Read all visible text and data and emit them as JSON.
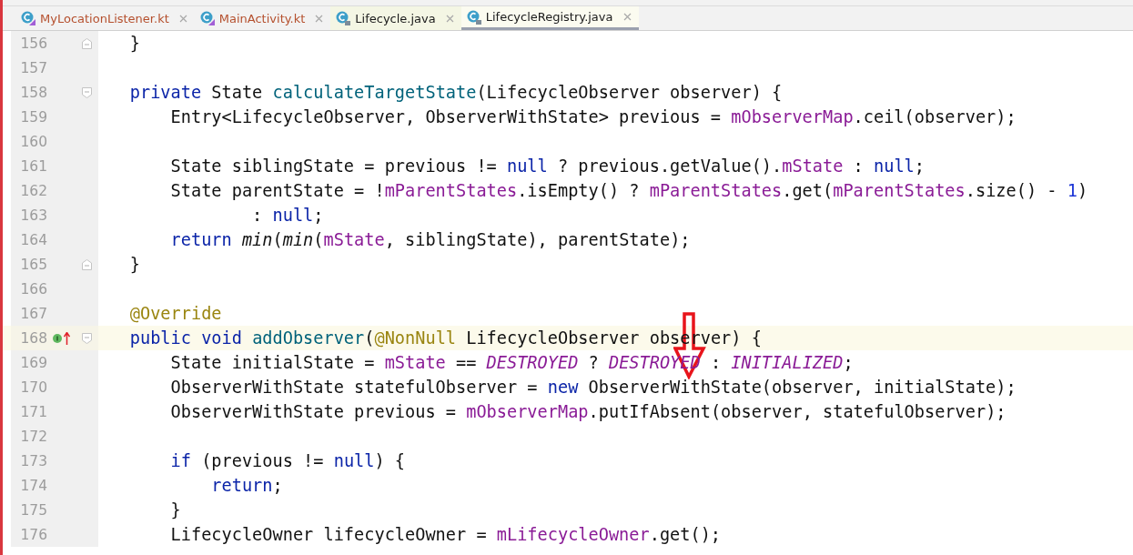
{
  "tabs": [
    {
      "label": "MyLocationListener.kt",
      "kind": "kotlin",
      "color": "#b5502e",
      "selected": false
    },
    {
      "label": "MainActivity.kt",
      "kind": "kotlin",
      "color": "#b5502e",
      "selected": false
    },
    {
      "label": "Lifecycle.java",
      "kind": "java",
      "color": "#1a1a1a",
      "selected": false
    },
    {
      "label": "LifecycleRegistry.java",
      "kind": "java",
      "color": "#1a1a1a",
      "selected": true
    }
  ],
  "editor": {
    "lines": [
      {
        "number": "156",
        "fold": {
          "kind": "end"
        },
        "tokens": [
          {
            "kind": "plain",
            "text": "    }"
          }
        ]
      },
      {
        "number": "157"
      },
      {
        "number": "158",
        "fold": {
          "kind": "start"
        },
        "tokens": [
          {
            "kind": "keyword",
            "text": "    private"
          },
          {
            "kind": "plain",
            "text": " State "
          },
          {
            "kind": "method",
            "text": "calculateTargetState"
          },
          {
            "kind": "plain",
            "text": "(LifecycleObserver observer) {"
          }
        ]
      },
      {
        "number": "159",
        "tokens": [
          {
            "kind": "plain",
            "text": "        Entry<LifecycleObserver, ObserverWithState> previous = "
          },
          {
            "kind": "field",
            "text": "mObserverMap"
          },
          {
            "kind": "plain",
            "text": ".ceil(observer);"
          }
        ]
      },
      {
        "number": "160"
      },
      {
        "number": "161",
        "tokens": [
          {
            "kind": "plain",
            "text": "        State siblingState = previous != "
          },
          {
            "kind": "keyword",
            "text": "null"
          },
          {
            "kind": "plain",
            "text": " ? previous.getValue()."
          },
          {
            "kind": "field",
            "text": "mState"
          },
          {
            "kind": "plain",
            "text": " : "
          },
          {
            "kind": "keyword",
            "text": "null"
          },
          {
            "kind": "plain",
            "text": ";"
          }
        ]
      },
      {
        "number": "162",
        "tokens": [
          {
            "kind": "plain",
            "text": "        State parentState = !"
          },
          {
            "kind": "field",
            "text": "mParentStates"
          },
          {
            "kind": "plain",
            "text": ".isEmpty() ? "
          },
          {
            "kind": "field",
            "text": "mParentStates"
          },
          {
            "kind": "plain",
            "text": ".get("
          },
          {
            "kind": "field",
            "text": "mParentStates"
          },
          {
            "kind": "plain",
            "text": ".size() - "
          },
          {
            "kind": "number",
            "text": "1"
          },
          {
            "kind": "plain",
            "text": ")"
          }
        ]
      },
      {
        "number": "163",
        "tokens": [
          {
            "kind": "plain",
            "text": "                : "
          },
          {
            "kind": "keyword",
            "text": "null"
          },
          {
            "kind": "plain",
            "text": ";"
          }
        ]
      },
      {
        "number": "164",
        "tokens": [
          {
            "kind": "keyword",
            "text": "        return "
          },
          {
            "kind": "static",
            "text": "min"
          },
          {
            "kind": "plain",
            "text": "("
          },
          {
            "kind": "static",
            "text": "min"
          },
          {
            "kind": "plain",
            "text": "("
          },
          {
            "kind": "field",
            "text": "mState"
          },
          {
            "kind": "plain",
            "text": ", siblingState), parentState);"
          }
        ]
      },
      {
        "number": "165",
        "fold": {
          "kind": "end"
        },
        "tokens": [
          {
            "kind": "plain",
            "text": "    }"
          }
        ]
      },
      {
        "number": "166"
      },
      {
        "number": "167",
        "tokens": [
          {
            "kind": "annotation",
            "text": "    @Override"
          }
        ]
      },
      {
        "number": "168",
        "current": true,
        "gutter_icons": [
          {
            "kind": "implements"
          },
          {
            "kind": "overrides"
          }
        ],
        "fold": {
          "kind": "start"
        },
        "tokens": [
          {
            "kind": "keyword",
            "text": "    public void "
          },
          {
            "kind": "method",
            "text": "addObserver"
          },
          {
            "kind": "plain",
            "text": "("
          },
          {
            "kind": "annotation",
            "text": "@NonNull"
          },
          {
            "kind": "plain",
            "text": " LifecycleObserver observer) {"
          }
        ]
      },
      {
        "number": "169",
        "tokens": [
          {
            "kind": "plain",
            "text": "        State initialState = "
          },
          {
            "kind": "field",
            "text": "mState"
          },
          {
            "kind": "plain",
            "text": " == "
          },
          {
            "kind": "constant",
            "text": "DESTROYED"
          },
          {
            "kind": "plain",
            "text": " ? "
          },
          {
            "kind": "constant",
            "text": "DESTROYED"
          },
          {
            "kind": "plain",
            "text": " : "
          },
          {
            "kind": "constant",
            "text": "INITIALIZED"
          },
          {
            "kind": "plain",
            "text": ";"
          }
        ]
      },
      {
        "number": "170",
        "tokens": [
          {
            "kind": "plain",
            "text": "        ObserverWithState statefulObserver = "
          },
          {
            "kind": "keyword",
            "text": "new"
          },
          {
            "kind": "plain",
            "text": " ObserverWithState(observer, initialState);"
          }
        ]
      },
      {
        "number": "171",
        "tokens": [
          {
            "kind": "plain",
            "text": "        ObserverWithState previous = "
          },
          {
            "kind": "field",
            "text": "mObserverMap"
          },
          {
            "kind": "plain",
            "text": ".putIfAbsent(observer, statefulObserver);"
          }
        ]
      },
      {
        "number": "172"
      },
      {
        "number": "173",
        "tokens": [
          {
            "kind": "keyword",
            "text": "        if"
          },
          {
            "kind": "plain",
            "text": " (previous != "
          },
          {
            "kind": "keyword",
            "text": "null"
          },
          {
            "kind": "plain",
            "text": ") {"
          }
        ]
      },
      {
        "number": "174",
        "tokens": [
          {
            "kind": "keyword",
            "text": "            return"
          },
          {
            "kind": "plain",
            "text": ";"
          }
        ]
      },
      {
        "number": "175",
        "tokens": [
          {
            "kind": "plain",
            "text": "        }"
          }
        ]
      },
      {
        "number": "176",
        "tokens": [
          {
            "kind": "plain",
            "text": "        LifecycleOwner lifecycleOwner = "
          },
          {
            "kind": "field",
            "text": "mLifecycleOwner"
          },
          {
            "kind": "plain",
            "text": ".get();"
          }
        ]
      }
    ]
  }
}
